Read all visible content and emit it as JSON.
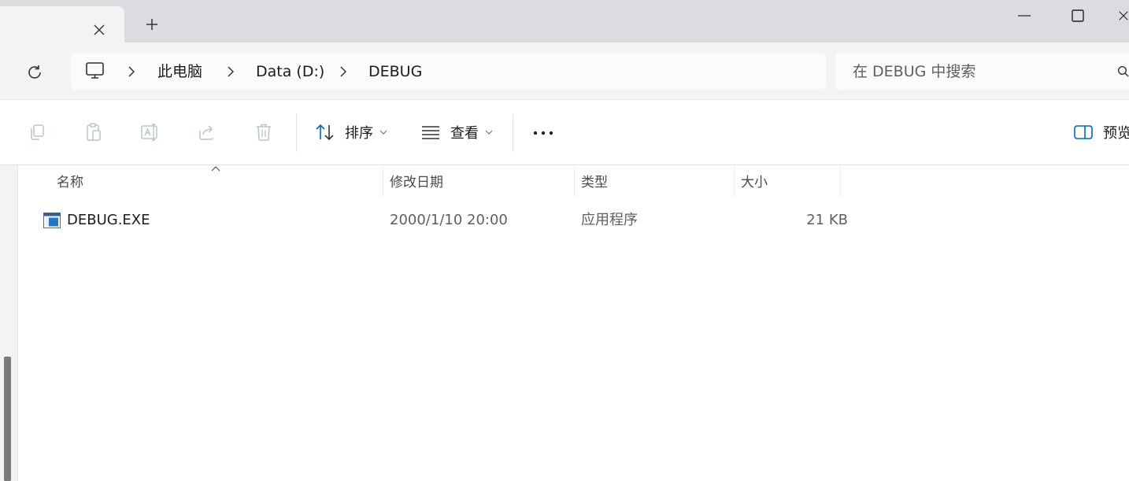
{
  "window": {
    "new_tab_symbol": "+"
  },
  "breadcrumb": {
    "root_icon": "computer-icon",
    "items": [
      "此电脑",
      "Data (D:)",
      "DEBUG"
    ]
  },
  "search": {
    "placeholder": "在 DEBUG 中搜索"
  },
  "toolbar": {
    "icons": [
      "copy-icon",
      "paste-icon",
      "rename-icon",
      "share-icon",
      "delete-icon"
    ],
    "sort_label": "排序",
    "view_label": "查看",
    "more_label": "•••",
    "preview_label": "预览"
  },
  "columns": {
    "name": "名称",
    "modified": "修改日期",
    "type": "类型",
    "size": "大小"
  },
  "files": [
    {
      "name": "DEBUG.EXE",
      "modified": "2000/1/10 20:00",
      "type": "应用程序",
      "size": "21 KB",
      "icon": "executable-icon"
    }
  ],
  "colors": {
    "accent": "#0067c0",
    "titlebar": "#dcdce0",
    "background": "#f3f3f3"
  }
}
